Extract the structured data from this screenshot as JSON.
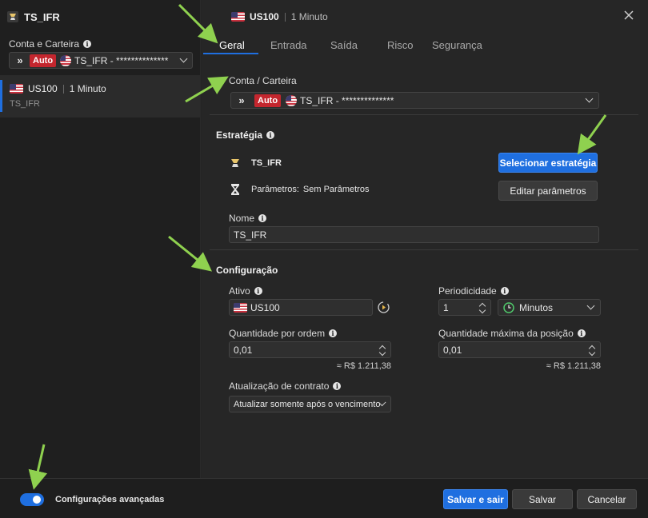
{
  "left_panel": {
    "title": "TS_IFR",
    "account_label": "Conta e Carteira",
    "account_badge": "Auto",
    "account_value": "TS_IFR - **************",
    "strategy_item": {
      "symbol": "US100",
      "period": "1 Minuto",
      "name": "TS_IFR"
    }
  },
  "header": {
    "symbol": "US100",
    "period": "1 Minuto"
  },
  "tabs": [
    "Geral",
    "Entrada",
    "Saída",
    "Risco",
    "Segurança"
  ],
  "conta": {
    "label": "Conta / Carteira",
    "badge": "Auto",
    "value": "TS_IFR - **************"
  },
  "estrategia": {
    "title": "Estratégia",
    "name": "TS_IFR",
    "params_label": "Parâmetros:",
    "params_value": "Sem Parâmetros",
    "select_button": "Selecionar estratégia",
    "edit_button": "Editar parâmetros",
    "nome_label": "Nome",
    "nome_value": "TS_IFR"
  },
  "configuracao": {
    "title": "Configuração",
    "ativo_label": "Ativo",
    "ativo_value": "US100",
    "periodicidade_label": "Periodicidade",
    "periodicidade_value": "1",
    "periodicidade_unit": "Minutos",
    "qtd_ordem_label": "Quantidade por ordem",
    "qtd_ordem_value": "0,01",
    "qtd_ordem_approx": "≈ R$ 1.211,38",
    "qtd_max_label": "Quantidade máxima da posição",
    "qtd_max_value": "0,01",
    "qtd_max_approx": "≈ R$ 1.211,38",
    "atualizacao_label": "Atualização de contrato",
    "atualizacao_value": "Atualizar somente após o vencimento"
  },
  "footer": {
    "advanced_label": "Configurações avançadas",
    "advanced_enabled": true,
    "save_exit": "Salvar e sair",
    "save": "Salvar",
    "cancel": "Cancelar"
  },
  "colors": {
    "accent": "#1f6fe0",
    "auto_badge": "#c4262e",
    "annotation_arrow": "#8fd14f"
  },
  "icons": {
    "close": "close-icon",
    "chevron": "chevron-down-icon",
    "info": "info-icon",
    "strategy": "strategy-logo-icon",
    "params": "hourglass-icon",
    "clock": "clock-icon",
    "refresh": "refresh-icon"
  }
}
